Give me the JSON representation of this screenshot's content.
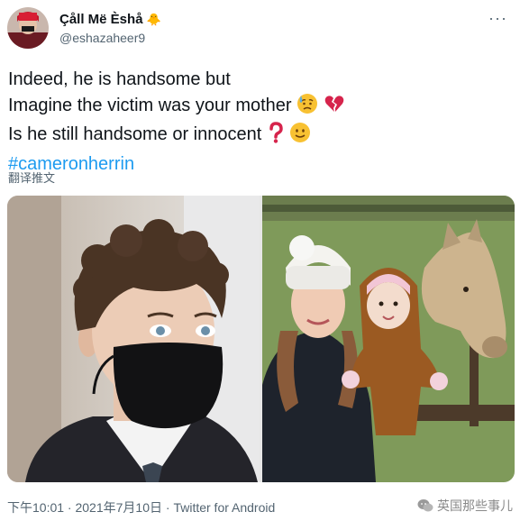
{
  "tweet": {
    "author": {
      "display_name": "Çåll Më Èshå",
      "name_emoji": "🐥",
      "handle": "@eshazaheer9",
      "avatar_icon": "avatar-image"
    },
    "more_label": "···",
    "lines": [
      {
        "text": "Indeed, he is handsome but"
      },
      {
        "text": "Imagine the victim was your mother",
        "emoji_icons": [
          "sad-sweat-emoji-icon",
          "broken-heart-emoji-icon"
        ]
      },
      {
        "text": "Is he still handsome or innocent",
        "emoji_icons": [
          "question-mark-emoji-icon",
          "slight-smile-emoji-icon"
        ]
      }
    ],
    "hashtag": "#cameronherrin",
    "translate_label": "翻译推文",
    "images": [
      {
        "icon": "photo-young-man-wearing-mask"
      },
      {
        "icon": "photo-woman-with-baby-and-horse"
      }
    ],
    "timestamp": "下午10:01 · 2021年7月10日",
    "separator": " · ",
    "client": "Twitter for Android"
  },
  "watermark": {
    "text": "英国那些事儿",
    "icon": "wechat-icon"
  },
  "colors": {
    "link": "#1d9bf0",
    "secondary": "#536471",
    "primary": "#0f1419"
  }
}
